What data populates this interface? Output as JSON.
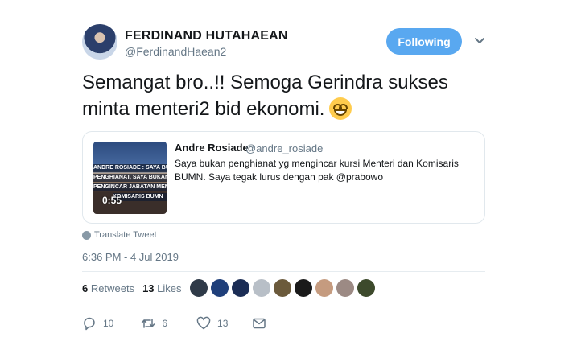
{
  "author": {
    "name": "FERDINAND HUTAHAEAN",
    "handle": "@FerdinandHaean2"
  },
  "follow_button": {
    "label": "Following"
  },
  "tweet": {
    "text": "Semangat bro..!! Semoga Gerindra sukses minta menteri2 bid ekonomi.",
    "emoji": "grinning-face-emoji"
  },
  "quoted_tweet": {
    "name": "Andre Rosiade",
    "handle": "@andre_rosiade",
    "text": "Saya bukan penghianat yg mengincar kursi Menteri dan Komisaris BUMN. Saya tegak lurus dengan pak @prabowo",
    "video": {
      "duration": "0:55",
      "caption_lines": [
        "ANDRE ROSIADE : SAYA BUKAN",
        "PENGHIANAT, SAYA BUKAN",
        "PENGINCAR JABATAN MENTERI",
        "KOMISARIS BUMN"
      ]
    }
  },
  "translate": {
    "label": "Translate Tweet"
  },
  "timestamp": "6:36 PM - 4 Jul 2019",
  "stats": {
    "retweets_count": "6",
    "retweets_label": "Retweets",
    "likes_count": "13",
    "likes_label": "Likes"
  },
  "likers": [
    {
      "color": "#2f3a48"
    },
    {
      "color": "#1f3f7a"
    },
    {
      "color": "#1b2d55"
    },
    {
      "color": "#b8bfc7"
    },
    {
      "color": "#6b5a3b"
    },
    {
      "color": "#1a1a1a"
    },
    {
      "color": "#c59b7f"
    },
    {
      "color": "#9c8a84"
    },
    {
      "color": "#3d4a2c"
    }
  ],
  "actions": {
    "reply_count": "10",
    "retweet_count": "6",
    "like_count": "13"
  },
  "colors": {
    "accent": "#1da1f2",
    "button": "#59a8f0",
    "muted": "#657786"
  }
}
